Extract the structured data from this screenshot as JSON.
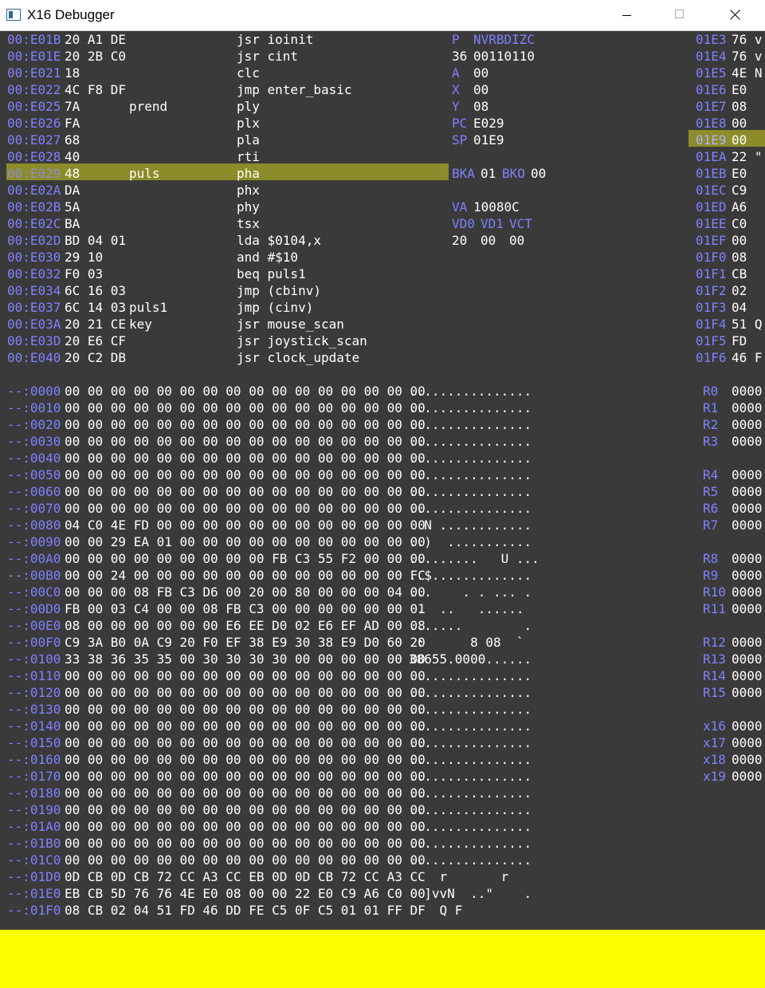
{
  "window": {
    "title": "X16 Debugger",
    "controls": [
      "minimize",
      "maximize",
      "close"
    ]
  },
  "colors": {
    "background": "#3a3a3a",
    "text": "#ffffff",
    "address": "#8080ff",
    "highlight": "#8c8c2a",
    "status_bar": "#ffff00"
  },
  "disassembly": [
    {
      "addr": "00:E01B",
      "bytes": "20 A1 DE",
      "label": "",
      "instr": "jsr ioinit",
      "current": false
    },
    {
      "addr": "00:E01E",
      "bytes": "20 2B C0",
      "label": "",
      "instr": "jsr cint",
      "current": false
    },
    {
      "addr": "00:E021",
      "bytes": "18",
      "label": "",
      "instr": "clc",
      "current": false
    },
    {
      "addr": "00:E022",
      "bytes": "4C F8 DF",
      "label": "",
      "instr": "jmp enter_basic",
      "current": false
    },
    {
      "addr": "00:E025",
      "bytes": "7A",
      "label": "prend",
      "instr": "ply",
      "current": false
    },
    {
      "addr": "00:E026",
      "bytes": "FA",
      "label": "",
      "instr": "plx",
      "current": false
    },
    {
      "addr": "00:E027",
      "bytes": "68",
      "label": "",
      "instr": "pla",
      "current": false
    },
    {
      "addr": "00:E028",
      "bytes": "40",
      "label": "",
      "instr": "rti",
      "current": false
    },
    {
      "addr": "00:E029",
      "bytes": "48",
      "label": "puls",
      "instr": "pha",
      "current": true
    },
    {
      "addr": "00:E02A",
      "bytes": "DA",
      "label": "",
      "instr": "phx",
      "current": false
    },
    {
      "addr": "00:E02B",
      "bytes": "5A",
      "label": "",
      "instr": "phy",
      "current": false
    },
    {
      "addr": "00:E02C",
      "bytes": "BA",
      "label": "",
      "instr": "tsx",
      "current": false
    },
    {
      "addr": "00:E02D",
      "bytes": "BD 04 01",
      "label": "",
      "instr": "lda $0104,x",
      "current": false
    },
    {
      "addr": "00:E030",
      "bytes": "29 10",
      "label": "",
      "instr": "and #$10",
      "current": false
    },
    {
      "addr": "00:E032",
      "bytes": "F0 03",
      "label": "",
      "instr": "beq puls1",
      "current": false
    },
    {
      "addr": "00:E034",
      "bytes": "6C 16 03",
      "label": "",
      "instr": "jmp (cbinv)",
      "current": false
    },
    {
      "addr": "00:E037",
      "bytes": "6C 14 03",
      "label": "puls1",
      "instr": "jmp (cinv)",
      "current": false
    },
    {
      "addr": "00:E03A",
      "bytes": "20 21 CE",
      "label": "key",
      "instr": "jsr mouse_scan",
      "current": false
    },
    {
      "addr": "00:E03D",
      "bytes": "20 E6 CF",
      "label": "",
      "instr": "jsr joystick_scan",
      "current": false
    },
    {
      "addr": "00:E040",
      "bytes": "20 C2 DB",
      "label": "",
      "instr": "jsr clock_update",
      "current": false
    }
  ],
  "cpu": {
    "p_label": "P",
    "p_flags": "NVRBDIZC",
    "p_value": "36",
    "p_bits": "00110110",
    "a_label": "A",
    "a_value": "00",
    "x_label": "X",
    "x_value": "00",
    "y_label": "Y",
    "y_value": "08",
    "pc_label": "PC",
    "pc_value": "E029",
    "sp_label": "SP",
    "sp_value": "01E9",
    "bka_label": "BKA",
    "bka_value": "01",
    "bko_label": "BKO",
    "bko_value": "00",
    "va_label": "VA",
    "va_value": "10080C",
    "vd0_label": "VD0",
    "vd1_label": "VD1",
    "vct_label": "VCT",
    "vd0_value": "20",
    "vd1_value": "00",
    "vct_value": "00"
  },
  "stack": [
    {
      "addr": "01E3",
      "val": "76 v",
      "current": false
    },
    {
      "addr": "01E4",
      "val": "76 v",
      "current": false
    },
    {
      "addr": "01E5",
      "val": "4E N",
      "current": false
    },
    {
      "addr": "01E6",
      "val": "E0",
      "current": false
    },
    {
      "addr": "01E7",
      "val": "08",
      "current": false
    },
    {
      "addr": "01E8",
      "val": "00",
      "current": false
    },
    {
      "addr": "01E9",
      "val": "00",
      "current": true
    },
    {
      "addr": "01EA",
      "val": "22 \"",
      "current": false
    },
    {
      "addr": "01EB",
      "val": "E0",
      "current": false
    },
    {
      "addr": "01EC",
      "val": "C9",
      "current": false
    },
    {
      "addr": "01ED",
      "val": "A6",
      "current": false
    },
    {
      "addr": "01EE",
      "val": "C0",
      "current": false
    },
    {
      "addr": "01EF",
      "val": "00",
      "current": false
    },
    {
      "addr": "01F0",
      "val": "08",
      "current": false
    },
    {
      "addr": "01F1",
      "val": "CB",
      "current": false
    },
    {
      "addr": "01F2",
      "val": "02",
      "current": false
    },
    {
      "addr": "01F3",
      "val": "04",
      "current": false
    },
    {
      "addr": "01F4",
      "val": "51 Q",
      "current": false
    },
    {
      "addr": "01F5",
      "val": "FD",
      "current": false
    },
    {
      "addr": "01F6",
      "val": "46 F",
      "current": false
    }
  ],
  "memory": [
    {
      "addr": "--:0000",
      "bytes": "00 00 00 00 00 00 00 00 00 00 00 00 00 00 00 00",
      "ascii": "................"
    },
    {
      "addr": "--:0010",
      "bytes": "00 00 00 00 00 00 00 00 00 00 00 00 00 00 00 00",
      "ascii": "................"
    },
    {
      "addr": "--:0020",
      "bytes": "00 00 00 00 00 00 00 00 00 00 00 00 00 00 00 00",
      "ascii": "................"
    },
    {
      "addr": "--:0030",
      "bytes": "00 00 00 00 00 00 00 00 00 00 00 00 00 00 00 00",
      "ascii": "................"
    },
    {
      "addr": "--:0040",
      "bytes": "00 00 00 00 00 00 00 00 00 00 00 00 00 00 00 00",
      "ascii": "................"
    },
    {
      "addr": "--:0050",
      "bytes": "00 00 00 00 00 00 00 00 00 00 00 00 00 00 00 00",
      "ascii": "................"
    },
    {
      "addr": "--:0060",
      "bytes": "00 00 00 00 00 00 00 00 00 00 00 00 00 00 00 00",
      "ascii": "................"
    },
    {
      "addr": "--:0070",
      "bytes": "00 00 00 00 00 00 00 00 00 00 00 00 00 00 00 00",
      "ascii": "................"
    },
    {
      "addr": "--:0080",
      "bytes": "04 C0 4E FD 00 00 00 00 00 00 00 00 00 00 00 00",
      "ascii": "  N ............"
    },
    {
      "addr": "--:0090",
      "bytes": "00 00 29 EA 01 00 00 00 00 00 00 00 00 00 00 00",
      "ascii": "..)  ..........."
    },
    {
      "addr": "--:00A0",
      "bytes": "00 00 00 00 00 00 00 00 00 FB C3 55 F2 00 00 00",
      "ascii": ".........   U ..."
    },
    {
      "addr": "--:00B0",
      "bytes": "00 00 24 00 00 00 00 00 00 00 00 00 00 00 00 FC",
      "ascii": "..$............."
    },
    {
      "addr": "--:00C0",
      "bytes": "00 00 00 08 FB C3 D6 00 20 00 80 00 00 00 04 00",
      "ascii": "...    . . ... ."
    },
    {
      "addr": "--:00D0",
      "bytes": "FB 00 03 C4 00 00 08 FB C3 00 00 00 00 00 00 01",
      "ascii": " .  ..   ......"
    },
    {
      "addr": "--:00E0",
      "bytes": "08 00 00 00 00 00 00 E6 EE D0 02 E6 EF AD 00 08",
      "ascii": ".......        ."
    },
    {
      "addr": "--:00F0",
      "bytes": "C9 3A B0 0A C9 20 F0 EF 38 E9 30 38 E9 D0 60 20",
      "ascii": " :      8 08  `"
    },
    {
      "addr": "--:0100",
      "bytes": "33 38 36 35 35 00 30 30 30 30 00 00 00 00 00 00",
      "ascii": "38655.0000......"
    },
    {
      "addr": "--:0110",
      "bytes": "00 00 00 00 00 00 00 00 00 00 00 00 00 00 00 00",
      "ascii": "................"
    },
    {
      "addr": "--:0120",
      "bytes": "00 00 00 00 00 00 00 00 00 00 00 00 00 00 00 00",
      "ascii": "................"
    },
    {
      "addr": "--:0130",
      "bytes": "00 00 00 00 00 00 00 00 00 00 00 00 00 00 00 00",
      "ascii": "................"
    },
    {
      "addr": "--:0140",
      "bytes": "00 00 00 00 00 00 00 00 00 00 00 00 00 00 00 00",
      "ascii": "................"
    },
    {
      "addr": "--:0150",
      "bytes": "00 00 00 00 00 00 00 00 00 00 00 00 00 00 00 00",
      "ascii": "................"
    },
    {
      "addr": "--:0160",
      "bytes": "00 00 00 00 00 00 00 00 00 00 00 00 00 00 00 00",
      "ascii": "................"
    },
    {
      "addr": "--:0170",
      "bytes": "00 00 00 00 00 00 00 00 00 00 00 00 00 00 00 00",
      "ascii": "................"
    },
    {
      "addr": "--:0180",
      "bytes": "00 00 00 00 00 00 00 00 00 00 00 00 00 00 00 00",
      "ascii": "................"
    },
    {
      "addr": "--:0190",
      "bytes": "00 00 00 00 00 00 00 00 00 00 00 00 00 00 00 00",
      "ascii": "................"
    },
    {
      "addr": "--:01A0",
      "bytes": "00 00 00 00 00 00 00 00 00 00 00 00 00 00 00 00",
      "ascii": "................"
    },
    {
      "addr": "--:01B0",
      "bytes": "00 00 00 00 00 00 00 00 00 00 00 00 00 00 00 00",
      "ascii": "................"
    },
    {
      "addr": "--:01C0",
      "bytes": "00 00 00 00 00 00 00 00 00 00 00 00 00 00 00 00",
      "ascii": "................"
    },
    {
      "addr": "--:01D0",
      "bytes": "0D CB 0D CB 72 CC A3 CC EB 0D 0D CB 72 CC A3 CC",
      "ascii": "    r       r"
    },
    {
      "addr": "--:01E0",
      "bytes": "EB CB 5D 76 76 4E E0 08 00 00 22 E0 C9 A6 C0 00",
      "ascii": "  ]vvN  ..\"    ."
    },
    {
      "addr": "--:01F0",
      "bytes": "08 CB 02 04 51 FD 46 DD FE C5 0F C5 01 01 FF DF",
      "ascii": "    Q F"
    }
  ],
  "vregs": [
    {
      "name": "R0",
      "val": "0000",
      "gap": false
    },
    {
      "name": "R1",
      "val": "0000",
      "gap": false
    },
    {
      "name": "R2",
      "val": "0000",
      "gap": false
    },
    {
      "name": "R3",
      "val": "0000",
      "gap": false
    },
    {
      "name": "R4",
      "val": "0000",
      "gap": true
    },
    {
      "name": "R5",
      "val": "0000",
      "gap": false
    },
    {
      "name": "R6",
      "val": "0000",
      "gap": false
    },
    {
      "name": "R7",
      "val": "0000",
      "gap": false
    },
    {
      "name": "R8",
      "val": "0000",
      "gap": true
    },
    {
      "name": "R9",
      "val": "0000",
      "gap": false
    },
    {
      "name": "R10",
      "val": "0000",
      "gap": false
    },
    {
      "name": "R11",
      "val": "0000",
      "gap": false
    },
    {
      "name": "R12",
      "val": "0000",
      "gap": true
    },
    {
      "name": "R13",
      "val": "0000",
      "gap": false
    },
    {
      "name": "R14",
      "val": "0000",
      "gap": false
    },
    {
      "name": "R15",
      "val": "0000",
      "gap": false
    },
    {
      "name": "x16",
      "val": "0000",
      "gap": true
    },
    {
      "name": "x17",
      "val": "0000",
      "gap": false
    },
    {
      "name": "x18",
      "val": "0000",
      "gap": false
    },
    {
      "name": "x19",
      "val": "0000",
      "gap": false
    }
  ]
}
